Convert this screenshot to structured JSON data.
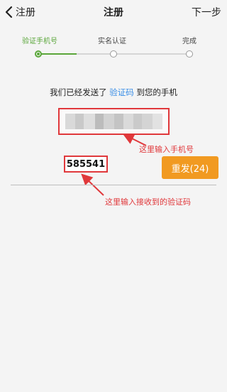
{
  "navbar": {
    "back_label": "注册",
    "title": "注册",
    "next_label": "下一步"
  },
  "stepper": {
    "steps": [
      {
        "label": "验证手机号",
        "state": "active"
      },
      {
        "label": "实名认证",
        "state": "pending"
      },
      {
        "label": "完成",
        "state": "pending"
      }
    ],
    "progress_fraction": 0.25,
    "active_color": "#5aa63a"
  },
  "message": {
    "prefix": "我们已经发送了 ",
    "link": "验证码",
    "suffix": " 到您的手机"
  },
  "phone": {
    "value_state": "obscured"
  },
  "annotations": {
    "phone_hint": "这里输入手机号",
    "code_hint": "这里输入接收到的验证码",
    "color": "#e0383b"
  },
  "code": {
    "value": "585541"
  },
  "resend": {
    "label": "重发(24)",
    "color": "#f19a21"
  }
}
